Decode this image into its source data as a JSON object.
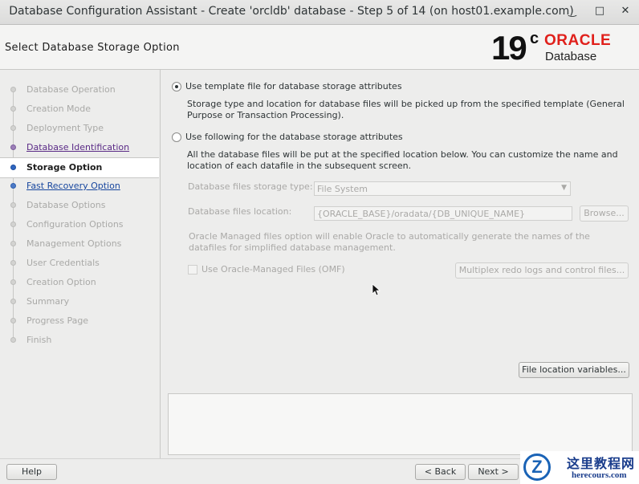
{
  "window": {
    "title": "Database Configuration Assistant - Create 'orcldb' database - Step 5 of 14 (on host01.example.com)",
    "minimize_glyph": "✓",
    "maximize_glyph": "□",
    "close_glyph": "✕"
  },
  "header": {
    "page_title": "Select Database Storage Option",
    "brand_version": "19",
    "brand_version_suffix": "c",
    "brand_company": "ORACLE",
    "brand_product": "Database"
  },
  "steps": [
    {
      "label": "Database Operation",
      "state": "disabled"
    },
    {
      "label": "Creation Mode",
      "state": "disabled"
    },
    {
      "label": "Deployment Type",
      "state": "disabled"
    },
    {
      "label": "Database Identification",
      "state": "visited"
    },
    {
      "label": "Storage Option",
      "state": "current"
    },
    {
      "label": "Fast Recovery Option",
      "state": "link"
    },
    {
      "label": "Database Options",
      "state": "disabled"
    },
    {
      "label": "Configuration Options",
      "state": "disabled"
    },
    {
      "label": "Management Options",
      "state": "disabled"
    },
    {
      "label": "User Credentials",
      "state": "disabled"
    },
    {
      "label": "Creation Option",
      "state": "disabled"
    },
    {
      "label": "Summary",
      "state": "disabled"
    },
    {
      "label": "Progress Page",
      "state": "disabled"
    },
    {
      "label": "Finish",
      "state": "disabled"
    }
  ],
  "options": {
    "template_label": "Use template file for database storage attributes",
    "template_desc": "Storage type and location for database files will be picked up from the specified template (General Purpose or Transaction Processing).",
    "following_label": "Use following for the database storage attributes",
    "following_desc": "All the database files will be put at the specified location below. You can customize the name and location of each datafile in the subsequent screen.",
    "selected": "template"
  },
  "storage": {
    "type_label": "Database files storage type:",
    "type_value": "File System",
    "location_label": "Database files location:",
    "location_value": "{ORACLE_BASE}/oradata/{DB_UNIQUE_NAME}",
    "browse_label": "Browse...",
    "omf_note": "Oracle Managed files option will enable Oracle to automatically generate the names of the datafiles for simplified database management.",
    "omf_checkbox_label": "Use Oracle-Managed Files (OMF)",
    "multiplex_label": "Multiplex redo logs and control files..."
  },
  "file_location_button": "File location variables...",
  "footer": {
    "help_label": "Help",
    "back_label": "< Back",
    "next_label": "Next >"
  },
  "watermark": {
    "mark": "Z",
    "text_cn": "这里教程网",
    "text_en": "herecours.com"
  }
}
